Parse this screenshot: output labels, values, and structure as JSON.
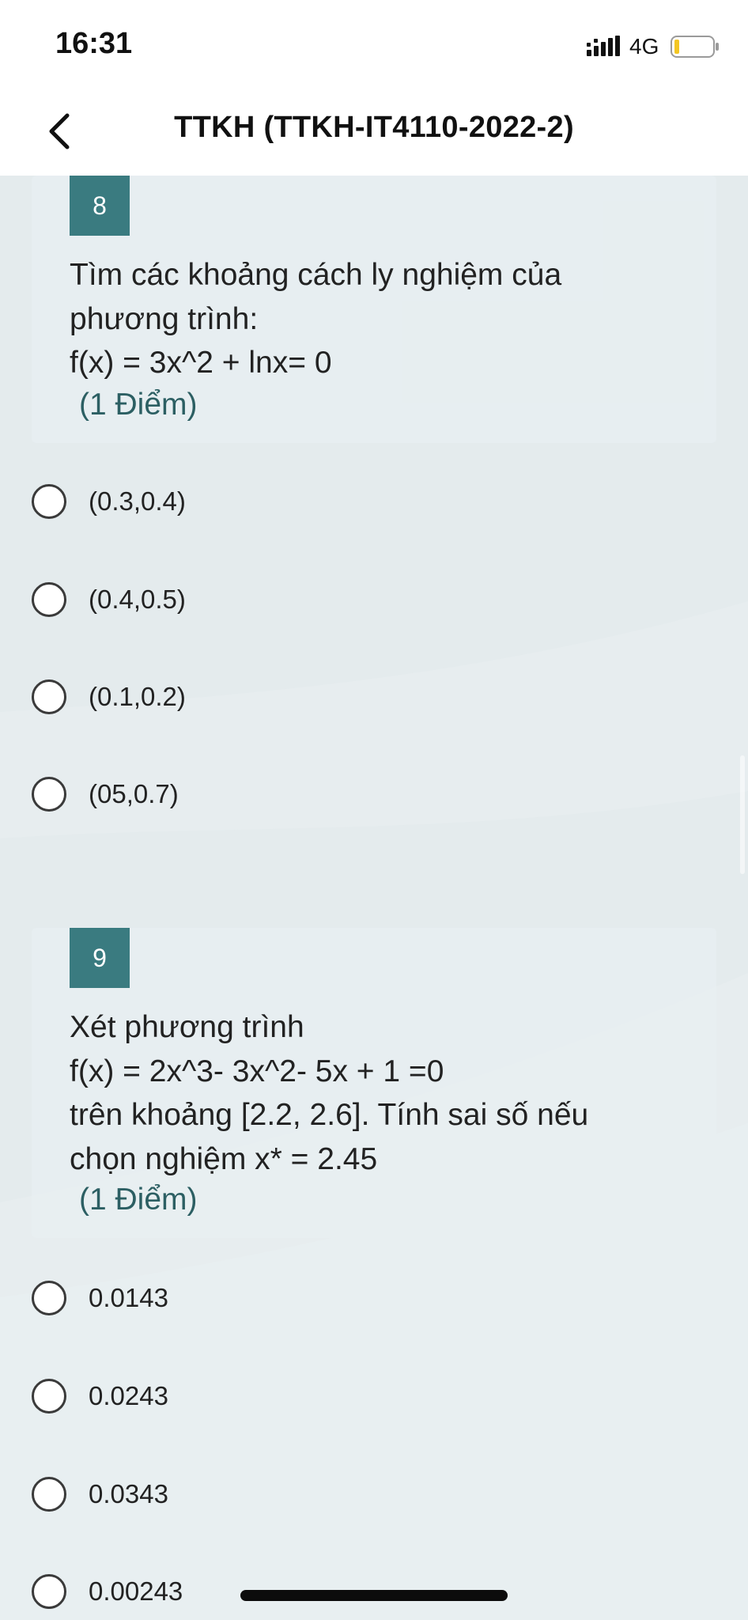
{
  "status_bar": {
    "time": "16:31",
    "network": "4G",
    "signal_icon": "signal-bars-icon",
    "battery_icon": "battery-low-icon"
  },
  "header": {
    "title": "TTKH (TTKH-IT4110-2022-2)",
    "back_icon": "chevron-left-icon"
  },
  "questions": [
    {
      "number": "8",
      "text": "Tìm các khoảng cách ly nghiệm của\nphương trình:\nf(x) = 3x^2 + lnx= 0",
      "points": "(1 Điểm)",
      "options": [
        {
          "label": "(0.3,0.4)",
          "selected": false
        },
        {
          "label": "(0.4,0.5)",
          "selected": false
        },
        {
          "label": "(0.1,0.2)",
          "selected": false
        },
        {
          "label": "(05,0.7)",
          "selected": false
        }
      ]
    },
    {
      "number": "9",
      "text": "Xét phương trình\nf(x) = 2x^3- 3x^2- 5x + 1 =0\ntrên khoảng [2.2, 2.6]. Tính sai số nếu\nchọn nghiệm x* = 2.45",
      "points": "(1 Điểm)",
      "options": [
        {
          "label": "0.0143",
          "selected": false
        },
        {
          "label": "0.0243",
          "selected": false
        },
        {
          "label": "0.0343",
          "selected": false
        },
        {
          "label": "0.00243",
          "selected": false
        }
      ]
    }
  ],
  "colors": {
    "badge": "#3a7b80",
    "points_text": "#2c5f63",
    "background": "#e4ebed",
    "header_background": "#ffffff"
  }
}
